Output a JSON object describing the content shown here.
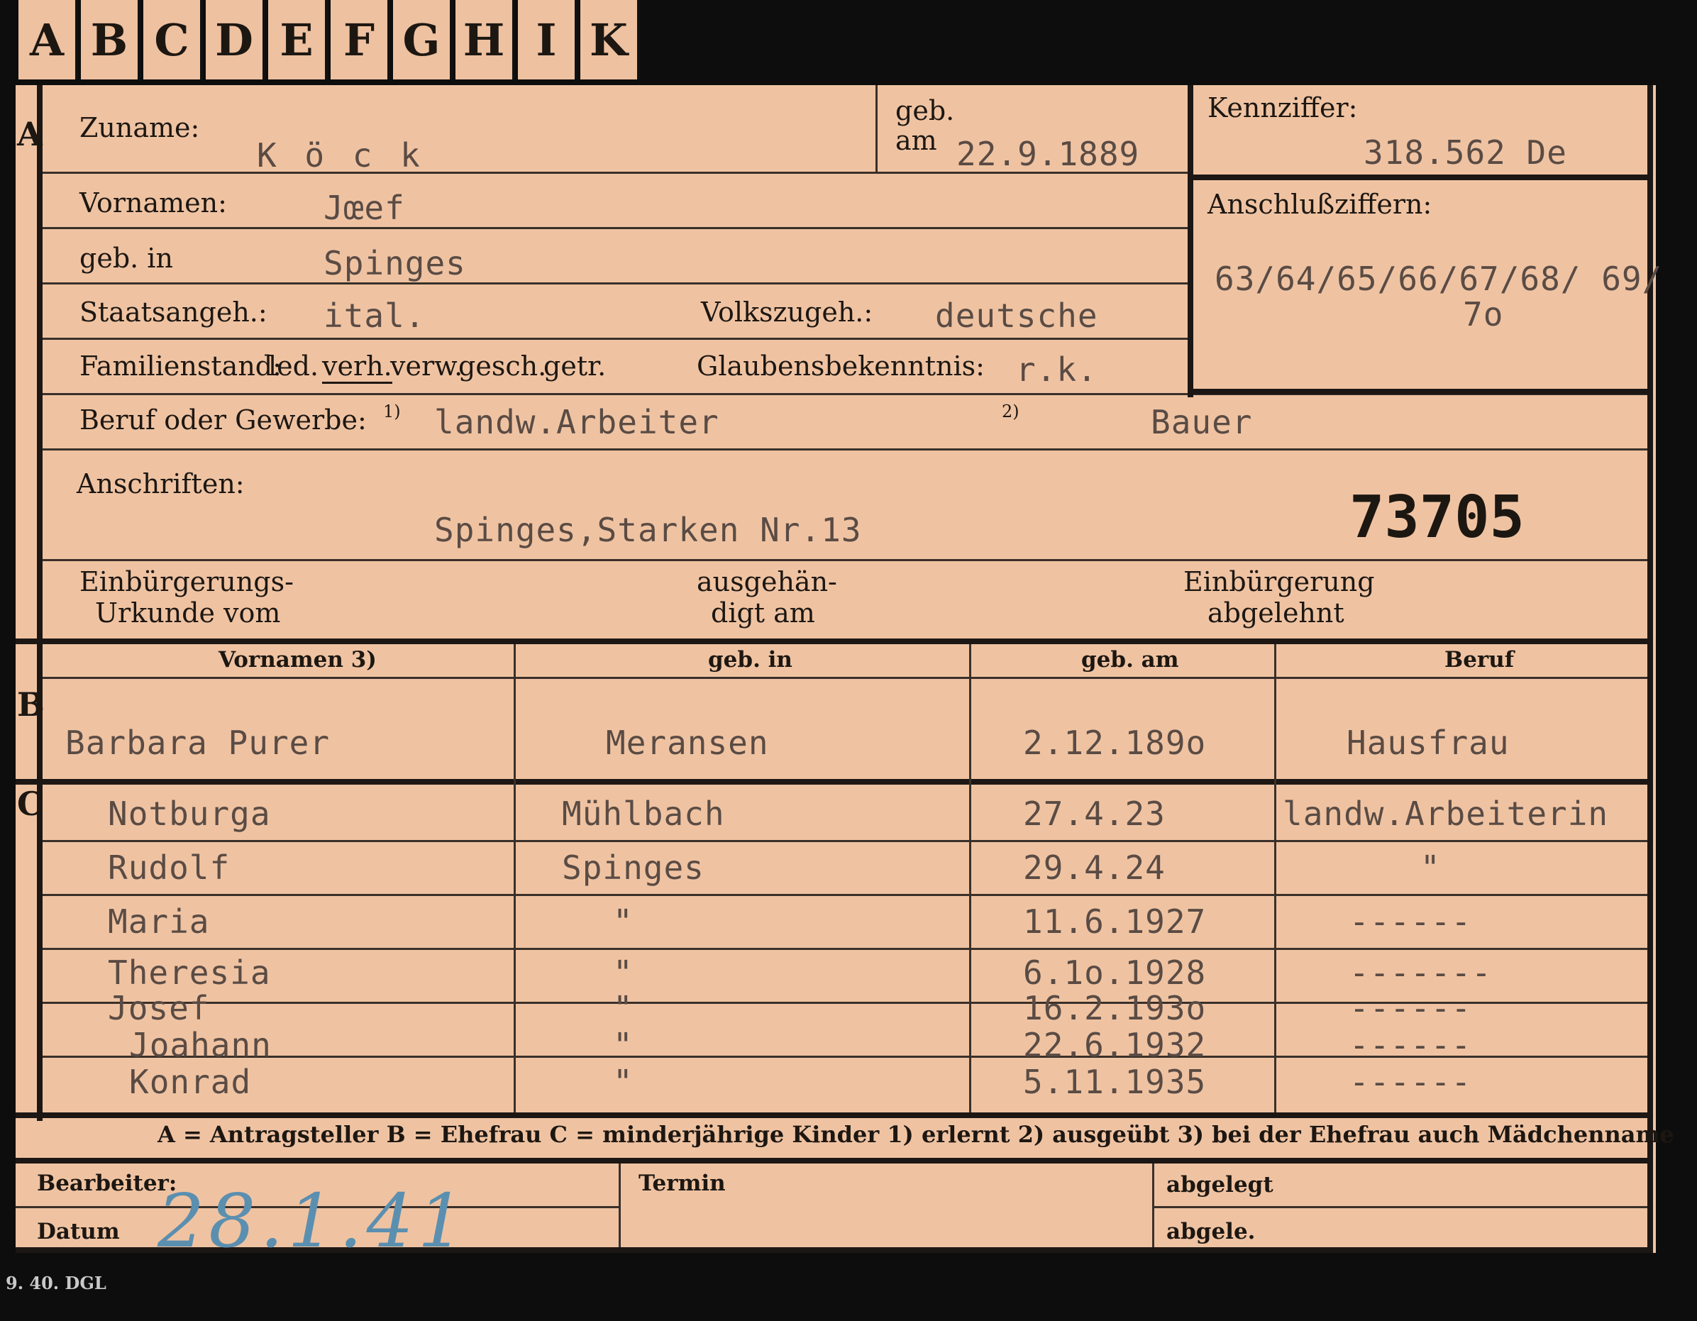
{
  "tabs": [
    "A",
    "B",
    "C",
    "D",
    "E",
    "F",
    "G",
    "H",
    "I",
    "K"
  ],
  "sections": {
    "a": "A",
    "b": "B",
    "c": "C"
  },
  "applicant": {
    "surname_label": "Zuname:",
    "surname": "K ö c k",
    "born_on_label_1": "geb.",
    "born_on_label_2": "am",
    "born_on": "22.9.1889",
    "id_label": "Kennziffer:",
    "id_value": "318.562  De",
    "connected_label": "Anschlußziffern:",
    "connected_line1": "63/64/65/66/67/68/ 69/",
    "connected_line2": "7o",
    "first_names_label": "Vornamen:",
    "first_names": "Jœef",
    "birthplace_label": "geb. in",
    "birthplace": "Spinges",
    "citizenship_label": "Staatsangeh.:",
    "citizenship": "ital.",
    "ethnicity_label": "Volkszugeh.:",
    "ethnicity": "deutsche",
    "marital_label": "Familienstand:",
    "marital_options": [
      "led.",
      "verh.",
      "verw.",
      "gesch.",
      "getr."
    ],
    "religion_label": "Glaubensbekenntnis:",
    "religion": "r.k.",
    "profession_label": "Beruf oder Gewerbe:",
    "prof1_mark": "1)",
    "profession1": "landw.Arbeiter",
    "prof2_mark": "2)",
    "profession2": "Bauer",
    "address_label": "Anschriften:",
    "address": "Spinges,Starken Nr.13",
    "big_number": "73705",
    "naturalization_label_1": "Einbürgerungs-",
    "naturalization_label_2": "Urkunde vom",
    "handed_label_1": "ausgehän-",
    "handed_label_2": "digt am",
    "rejected_label_1": "Einbürgerung",
    "rejected_label_2": "abgelehnt"
  },
  "table_headers": [
    "Vornamen 3)",
    "geb. in",
    "geb. am",
    "Beruf"
  ],
  "wife": {
    "name": "Barbara Purer",
    "birthplace": "Meransen",
    "born": "2.12.189o",
    "profession": "Hausfrau"
  },
  "children": [
    {
      "name": "Notburga",
      "birthplace": "Mühlbach",
      "born": "27.4.23",
      "profession": "landw.Arbeiterin"
    },
    {
      "name": "Rudolf",
      "birthplace": "Spinges",
      "born": "29.4.24",
      "profession": "\""
    },
    {
      "name": "Maria",
      "birthplace": "\"",
      "born": "11.6.1927",
      "profession": "------"
    },
    {
      "name": "Theresia",
      "birthplace": "\"",
      "born": "6.1o.1928",
      "profession": "-------"
    },
    {
      "name": "Josef",
      "birthplace": "\"",
      "born": "16.2.193o",
      "profession": "------"
    },
    {
      "name": "Joahann",
      "birthplace": "\"",
      "born": "22.6.1932",
      "profession": "------"
    },
    {
      "name": "Konrad",
      "birthplace": "\"",
      "born": "5.11.1935",
      "profession": "------"
    }
  ],
  "legend": "A = Antragsteller   B = Ehefrau   C = minderjährige Kinder   1) erlernt   2) ausgeübt   3) bei der Ehefrau auch Mädchenname",
  "footer": {
    "clerk_label": "Bearbeiter:",
    "date_label": "Datum",
    "date_handwritten": "28.1.41",
    "term_label": "Termin",
    "filed_label": "abgelegt",
    "filed2_label": "abgele.",
    "print_code": "9. 40. DGL"
  },
  "colors": {
    "card": "#efc3a2",
    "ink": "#1d1712",
    "typewriter": "#5a4b44",
    "handwriting": "#5b8fb0",
    "background": "#0d0d0d"
  }
}
